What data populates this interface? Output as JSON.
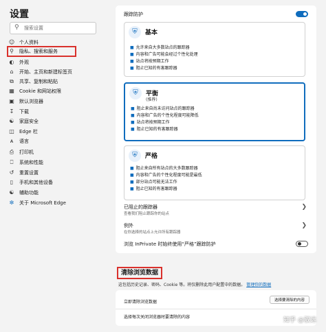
{
  "sidebar": {
    "title": "设置",
    "search_placeholder": "搜索设置",
    "items": [
      {
        "label": "个人资料",
        "icon": "person-icon"
      },
      {
        "label": "隐私、搜索和服务",
        "icon": "lock-icon"
      },
      {
        "label": "外观",
        "icon": "appearance-icon"
      },
      {
        "label": "开始、主页和新建标签页",
        "icon": "home-icon"
      },
      {
        "label": "共享、复制和粘贴",
        "icon": "share-icon"
      },
      {
        "label": "Cookie 和网站权限",
        "icon": "cookie-icon"
      },
      {
        "label": "默认浏览器",
        "icon": "browser-icon"
      },
      {
        "label": "下载",
        "icon": "download-icon"
      },
      {
        "label": "家庭安全",
        "icon": "family-icon"
      },
      {
        "label": "Edge 栏",
        "icon": "edge-bar-icon"
      },
      {
        "label": "语言",
        "icon": "language-icon"
      },
      {
        "label": "打印机",
        "icon": "printer-icon"
      },
      {
        "label": "系统和性能",
        "icon": "system-icon"
      },
      {
        "label": "重置设置",
        "icon": "reset-icon"
      },
      {
        "label": "手机和其他设备",
        "icon": "phone-icon"
      },
      {
        "label": "辅助功能",
        "icon": "accessibility-icon"
      },
      {
        "label": "关于 Microsoft Edge",
        "icon": "edge-logo-icon"
      }
    ]
  },
  "tracking": {
    "header_label": "跟踪防护",
    "enabled": true,
    "cards": [
      {
        "title": "基本",
        "subtitle": "",
        "icon": "shield-basic-icon",
        "bullets": [
          "允许来自大多数站点的跟踪器",
          "内容和广告可能会经过个性化处理",
          "站点将按预期工作",
          "阻止已知的有害跟踪器"
        ]
      },
      {
        "title": "平衡",
        "subtitle": "(推荐)",
        "icon": "shield-balanced-icon",
        "bullets": [
          "阻止来自尚未访问站点的跟踪器",
          "内容和广告的个性化程度可能降低",
          "站点将按预期工作",
          "阻止已知的有害跟踪器"
        ]
      },
      {
        "title": "严格",
        "subtitle": "",
        "icon": "shield-strict-icon",
        "bullets": [
          "阻止来自所有站点的大多数跟踪器",
          "内容和广告的个性化程度可能是最低",
          "部分站点可能无法工作",
          "阻止已知的有害跟踪器"
        ]
      }
    ],
    "blocked_label": "已阻止的跟踪器",
    "blocked_desc": "查看我们阻止跟踪你的站点",
    "exceptions_label": "例外",
    "exceptions_desc": "在你选择的站点上允许所有跟踪器",
    "inprivate_label": "浏览 InPrivate 时始终使用“严格”跟踪防护",
    "inprivate_enabled": false
  },
  "clear": {
    "title": "清除浏览数据",
    "desc": "这包括历史记录、密码、Cookie 等。将仅删除此用户配置中的数据。",
    "manage_link": "管理你的数据",
    "now_label": "立即清除浏览数据",
    "choose_button": "选择要清除的内容",
    "on_close_label": "选择每次关闭浏览器时要清除的内容"
  },
  "watermark": "知乎 @驭远"
}
